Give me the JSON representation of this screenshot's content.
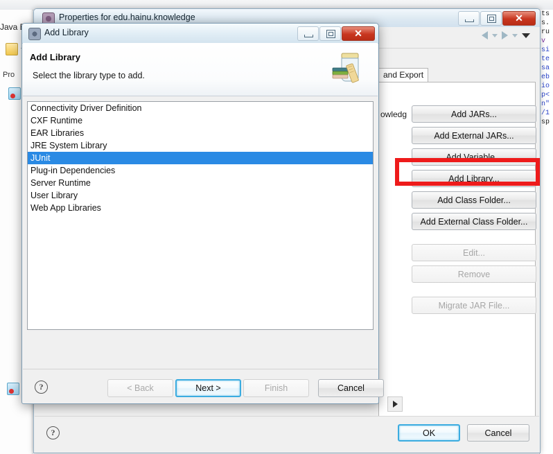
{
  "workbench": {
    "perspective_label": "Java EE",
    "view_label": "Pro",
    "editor_code_lines": [
      "ts",
      "s.",
      "",
      "ru",
      " v",
      "si",
      "",
      "te",
      "sa",
      "eb",
      "io",
      "p<",
      "",
      "n\"",
      "/1",
      "sp"
    ]
  },
  "properties_window": {
    "title": "Properties for edu.hainu.knowledge",
    "window_icon": "properties-icon",
    "minimize_label": "Minimize",
    "maximize_label": "Maximize",
    "close_label": "Close",
    "nav_back_icon": "arrow-left-icon",
    "nav_forward_icon": "arrow-right-icon",
    "nav_menu_icon": "chevron-down-icon",
    "visible_tab_label": "and Export",
    "visible_field_label": "owledg",
    "buttons": [
      {
        "label": "Add JARs...",
        "enabled": true,
        "highlighted": false
      },
      {
        "label": "Add External JARs...",
        "enabled": true,
        "highlighted": false
      },
      {
        "label": "Add Variable...",
        "enabled": true,
        "highlighted": false
      },
      {
        "label": "Add Library...",
        "enabled": true,
        "highlighted": true
      },
      {
        "label": "Add Class Folder...",
        "enabled": true,
        "highlighted": false
      },
      {
        "label": "Add External Class Folder...",
        "enabled": true,
        "highlighted": false
      },
      {
        "label": "Edit...",
        "enabled": false,
        "highlighted": false
      },
      {
        "label": "Remove",
        "enabled": false,
        "highlighted": false
      },
      {
        "label": "Migrate JAR File...",
        "enabled": false,
        "highlighted": false
      }
    ],
    "help_glyph": "?",
    "ok_label": "OK",
    "cancel_label": "Cancel"
  },
  "dialog": {
    "window_title": "Add Library",
    "window_icon": "add-library-icon",
    "minimize_label": "Minimize",
    "maximize_label": "Maximize",
    "close_label": "Close",
    "heading": "Add Library",
    "subheading": "Select the library type to add.",
    "banner_icon": "jar-with-books-icon",
    "library_types": [
      "Connectivity Driver Definition",
      "CXF Runtime",
      "EAR Libraries",
      "JRE System Library",
      "JUnit",
      "Plug-in Dependencies",
      "Server Runtime",
      "User Library",
      "Web App Libraries"
    ],
    "selected_library_type": "JUnit",
    "help_glyph": "?",
    "back_label": "< Back",
    "next_label": "Next >",
    "finish_label": "Finish",
    "cancel_label": "Cancel",
    "back_enabled": false,
    "next_enabled": true,
    "finish_enabled": false,
    "cancel_enabled": true
  },
  "annotation": {
    "type": "red-rectangle-highlight",
    "target": "Add Library...",
    "color": "#ee1b1b"
  },
  "colors": {
    "selection_blue": "#2a8ae4",
    "annotation_red": "#ee1b1b",
    "default_button_border": "#3bace0",
    "close_button_red": "#c8361f"
  }
}
